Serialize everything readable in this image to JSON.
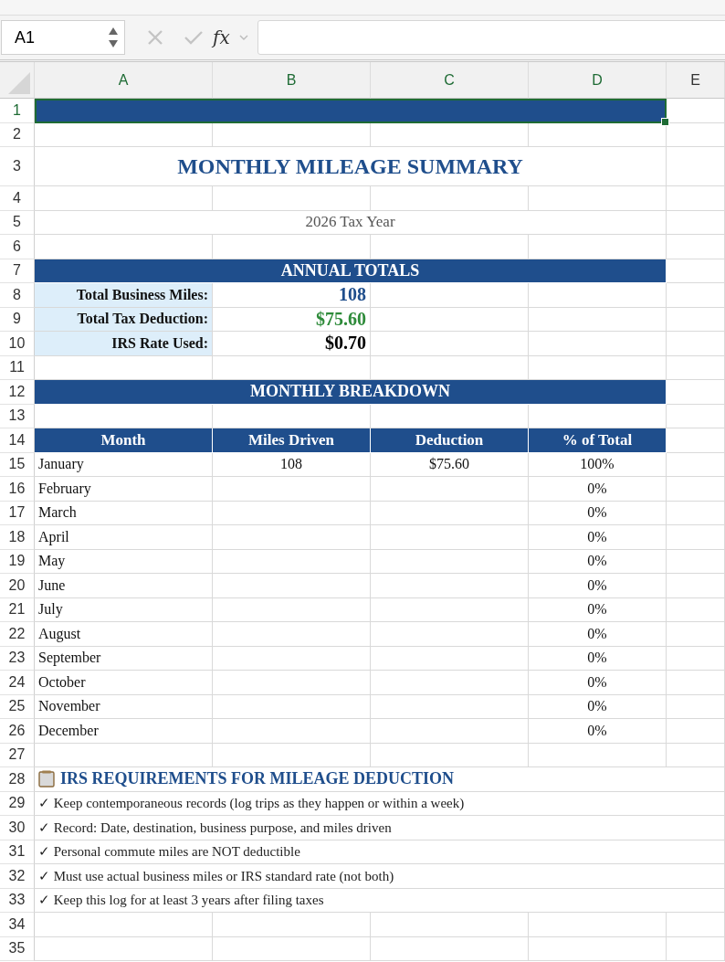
{
  "formula_bar": {
    "name_box": "A1",
    "function_label": "fx"
  },
  "columns": [
    {
      "label": "A",
      "selected": true
    },
    {
      "label": "B",
      "selected": true
    },
    {
      "label": "C",
      "selected": true
    },
    {
      "label": "D",
      "selected": true
    },
    {
      "label": "E",
      "selected": false
    }
  ],
  "rows": [
    {
      "number": "1",
      "selected": true,
      "kind": "banner"
    },
    {
      "number": "2",
      "selected": false,
      "kind": "blank"
    },
    {
      "number": "3",
      "selected": false,
      "kind": "title",
      "text": "MONTHLY MILEAGE SUMMARY"
    },
    {
      "number": "4",
      "selected": false,
      "kind": "blank"
    },
    {
      "number": "5",
      "selected": false,
      "kind": "subtitle",
      "text": "2026 Tax Year"
    },
    {
      "number": "6",
      "selected": false,
      "kind": "blank"
    },
    {
      "number": "7",
      "selected": false,
      "kind": "section",
      "text": "ANNUAL TOTALS"
    },
    {
      "number": "8",
      "selected": false,
      "kind": "stat",
      "label": "Total Business Miles:",
      "value": "108",
      "color": "#1f4e8c"
    },
    {
      "number": "9",
      "selected": false,
      "kind": "stat",
      "label": "Total Tax Deduction:",
      "value": "$75.60",
      "color": "#2e8b3a"
    },
    {
      "number": "10",
      "selected": false,
      "kind": "stat",
      "label": "IRS Rate Used:",
      "value": "$0.70",
      "color": "#000000"
    },
    {
      "number": "11",
      "selected": false,
      "kind": "blank"
    },
    {
      "number": "12",
      "selected": false,
      "kind": "section",
      "text": "MONTHLY BREAKDOWN"
    },
    {
      "number": "13",
      "selected": false,
      "kind": "blank"
    },
    {
      "number": "14",
      "selected": false,
      "kind": "table_header",
      "cells": [
        "Month",
        "Miles Driven",
        "Deduction",
        "% of Total"
      ]
    },
    {
      "number": "15",
      "selected": false,
      "kind": "month",
      "month": "January",
      "miles": "108",
      "deduction": "$75.60",
      "percent": "100%"
    },
    {
      "number": "16",
      "selected": false,
      "kind": "month",
      "month": "February",
      "percent": "0%"
    },
    {
      "number": "17",
      "selected": false,
      "kind": "month",
      "month": "March",
      "percent": "0%"
    },
    {
      "number": "18",
      "selected": false,
      "kind": "month",
      "month": "April",
      "percent": "0%"
    },
    {
      "number": "19",
      "selected": false,
      "kind": "month",
      "month": "May",
      "percent": "0%"
    },
    {
      "number": "20",
      "selected": false,
      "kind": "month",
      "month": "June",
      "percent": "0%"
    },
    {
      "number": "21",
      "selected": false,
      "kind": "month",
      "month": "July",
      "percent": "0%"
    },
    {
      "number": "22",
      "selected": false,
      "kind": "month",
      "month": "August",
      "percent": "0%"
    },
    {
      "number": "23",
      "selected": false,
      "kind": "month",
      "month": "September",
      "percent": "0%"
    },
    {
      "number": "24",
      "selected": false,
      "kind": "month",
      "month": "October",
      "percent": "0%"
    },
    {
      "number": "25",
      "selected": false,
      "kind": "month",
      "month": "November",
      "percent": "0%"
    },
    {
      "number": "26",
      "selected": false,
      "kind": "month",
      "month": "December",
      "percent": "0%"
    },
    {
      "number": "27",
      "selected": false,
      "kind": "blank"
    },
    {
      "number": "28",
      "selected": false,
      "kind": "note_heading",
      "text": "IRS REQUIREMENTS FOR MILEAGE DEDUCTION"
    },
    {
      "number": "29",
      "selected": false,
      "kind": "note",
      "text": "✓ Keep contemporaneous records (log trips as they happen or within a week)"
    },
    {
      "number": "30",
      "selected": false,
      "kind": "note",
      "text": "✓ Record: Date, destination, business purpose, and miles driven"
    },
    {
      "number": "31",
      "selected": false,
      "kind": "note",
      "text": "✓ Personal commute miles are NOT deductible"
    },
    {
      "number": "32",
      "selected": false,
      "kind": "note",
      "text": "✓ Must use actual business miles or IRS standard rate (not both)"
    },
    {
      "number": "33",
      "selected": false,
      "kind": "note",
      "text": "✓ Keep this log for at least 3 years after filing taxes"
    },
    {
      "number": "34",
      "selected": false,
      "kind": "blank"
    },
    {
      "number": "35",
      "selected": false,
      "kind": "blank"
    }
  ]
}
